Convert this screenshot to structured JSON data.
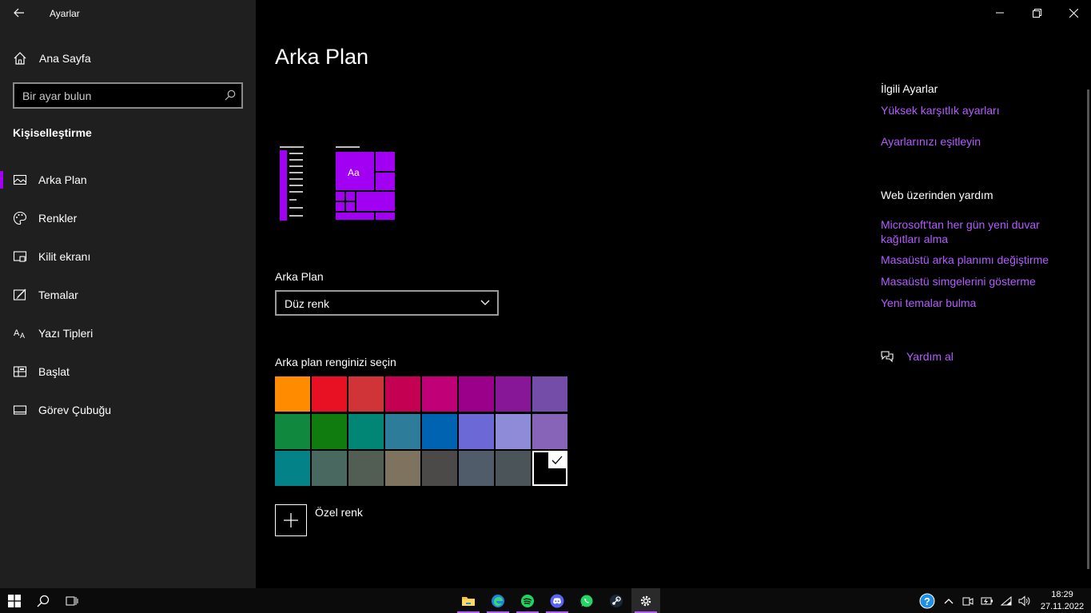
{
  "window": {
    "title": "Ayarlar"
  },
  "sidebar": {
    "home_label": "Ana Sayfa",
    "search_placeholder": "Bir ayar bulun",
    "section_title": "Kişiselleştirme",
    "items": [
      {
        "label": "Arka Plan",
        "icon": "picture-icon",
        "active": true
      },
      {
        "label": "Renkler",
        "icon": "palette-icon",
        "active": false
      },
      {
        "label": "Kilit ekranı",
        "icon": "lock-screen-icon",
        "active": false
      },
      {
        "label": "Temalar",
        "icon": "theme-brush-icon",
        "active": false
      },
      {
        "label": "Yazı Tipleri",
        "icon": "font-icon",
        "active": false
      },
      {
        "label": "Başlat",
        "icon": "start-icon",
        "active": false
      },
      {
        "label": "Görev Çubuğu",
        "icon": "taskbar-icon",
        "active": false
      }
    ]
  },
  "main": {
    "title": "Arka Plan",
    "preview_text": "Aa",
    "background_label": "Arka Plan",
    "background_value": "Düz renk",
    "color_label": "Arka plan renginizi seçin",
    "custom_color_label": "Özel renk",
    "accent": "#a100f2",
    "swatches": [
      "#ff8c00",
      "#e81123",
      "#d13438",
      "#c30052",
      "#bf0077",
      "#9a0089",
      "#881798",
      "#744da9",
      "#10893e",
      "#107c10",
      "#018574",
      "#2d7d9a",
      "#0063b1",
      "#6b69d6",
      "#8e8cd8",
      "#8764b8",
      "#038387",
      "#486860",
      "#525e54",
      "#7e735f",
      "#4c4a48",
      "#515c6b",
      "#4a5459",
      "#000000"
    ],
    "selected_swatch": 23
  },
  "related": {
    "title": "İlgili Ayarlar",
    "links": [
      "Yüksek karşıtlık ayarları",
      "Ayarlarınızı eşitleyin"
    ],
    "web_title": "Web üzerinden yardım",
    "web_links": [
      "Microsoft'tan her gün yeni duvar kağıtları alma",
      "Masaüstü arka planımı değiştirme",
      "Masaüstü simgelerini gösterme",
      "Yeni temalar bulma"
    ],
    "help_label": "Yardım al"
  },
  "taskbar": {
    "time": "18:29",
    "date": "27.11.2022",
    "apps": [
      "file-explorer-icon",
      "edge-icon",
      "spotify-icon",
      "discord-icon",
      "whatsapp-icon",
      "steam-icon",
      "settings-icon"
    ],
    "link_color": "#b45cff"
  }
}
